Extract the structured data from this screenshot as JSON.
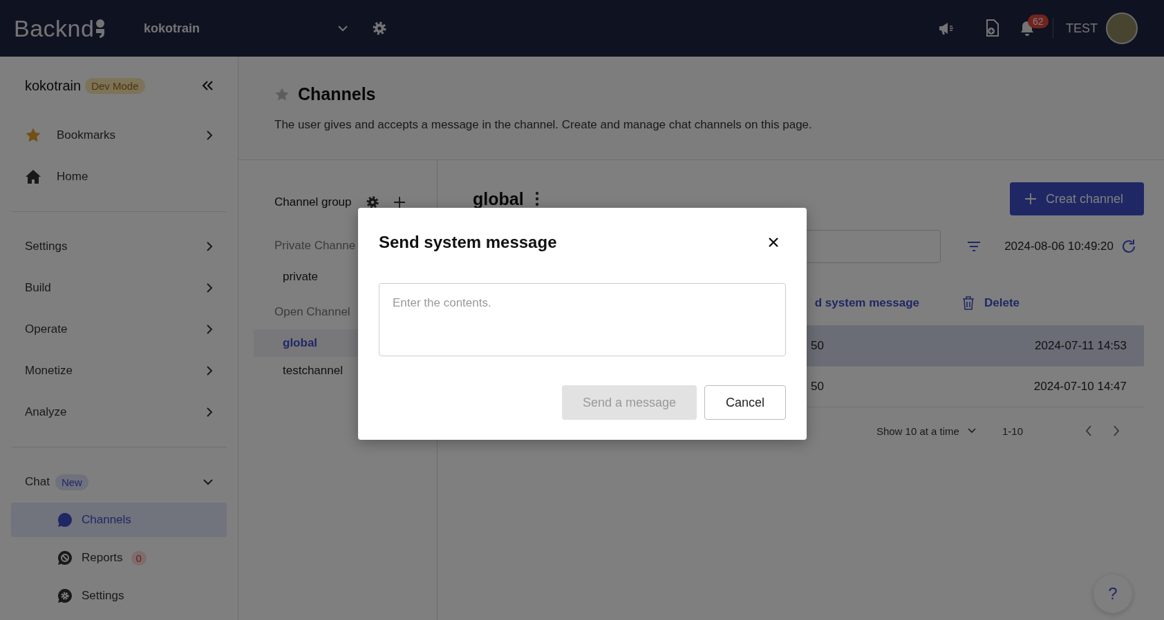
{
  "topbar": {
    "logo": "Backnd",
    "project": "kokotrain",
    "notification_count": "62",
    "user": "TEST"
  },
  "sidebar": {
    "project": "kokotrain",
    "mode_badge": "Dev Mode",
    "top_items": [
      {
        "label": "Bookmarks",
        "kind": "bookmarks"
      },
      {
        "label": "Home",
        "kind": "home"
      }
    ],
    "menu_items": [
      {
        "label": "Settings",
        "expanded": false
      },
      {
        "label": "Build",
        "expanded": false
      },
      {
        "label": "Operate",
        "expanded": false
      },
      {
        "label": "Monetize",
        "expanded": false
      },
      {
        "label": "Analyze",
        "expanded": false
      }
    ],
    "chat": {
      "label": "Chat",
      "badge": "New",
      "expanded": true,
      "children": [
        {
          "label": "Channels",
          "kind": "channels",
          "selected": true
        },
        {
          "label": "Reports",
          "kind": "reports",
          "badge": "0",
          "selected": false
        },
        {
          "label": "Settings",
          "kind": "settings",
          "selected": false
        }
      ]
    }
  },
  "page": {
    "title": "Channels",
    "description": "The user gives and accepts a message in the channel. Create and manage chat channels on this page."
  },
  "channel_groups": {
    "title": "Channel group",
    "groups": [
      {
        "name": "Private Channe",
        "channels": [
          {
            "name": "private",
            "selected": false
          }
        ]
      },
      {
        "name": "Open Channel",
        "channels": [
          {
            "name": "global",
            "selected": true
          },
          {
            "name": "testchannel",
            "selected": false
          }
        ]
      }
    ]
  },
  "channel": {
    "name": "global",
    "create_button": "Creat channel",
    "timestamp": "2024-08-06 10:49:20",
    "actions": [
      {
        "label": "d system message",
        "kind": "send"
      },
      {
        "label": "Delete",
        "kind": "delete"
      }
    ],
    "rows": [
      {
        "cells": [
          "50",
          "2024-07-11 14:53"
        ],
        "selected": true
      },
      {
        "cells": [
          "50",
          "2024-07-10 14:47"
        ],
        "selected": false
      }
    ],
    "pagination": {
      "page_size": "Show 10 at a time",
      "range": "1-10"
    }
  },
  "modal": {
    "title": "Send system message",
    "placeholder": "Enter the contents.",
    "buttons": [
      {
        "label": "Send a message",
        "kind": "primary",
        "disabled": true
      },
      {
        "label": "Cancel",
        "kind": "secondary",
        "disabled": false
      }
    ]
  },
  "help": "?"
}
